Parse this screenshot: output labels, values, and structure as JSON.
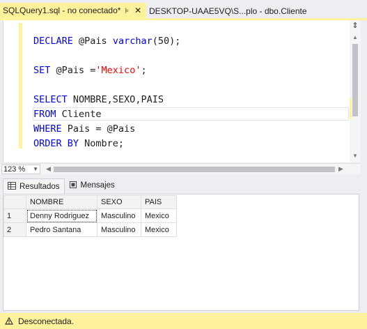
{
  "tabs": {
    "active": {
      "title": "SQLQuery1.sql - no conectado*",
      "pin": "⊧",
      "close": "✕"
    },
    "inactive": {
      "title": "DESKTOP-UAAE5VQ\\S...plo - dbo.Cliente"
    }
  },
  "editor": {
    "lines": [
      [
        {
          "t": "DECLARE",
          "c": "kw"
        },
        {
          "t": " @Pais ",
          "c": "txt"
        },
        {
          "t": "varchar",
          "c": "kw"
        },
        {
          "t": "(50);",
          "c": "txt"
        }
      ],
      [],
      [
        {
          "t": "SET",
          "c": "kw"
        },
        {
          "t": " @Pais =",
          "c": "txt"
        },
        {
          "t": "'Mexico'",
          "c": "str"
        },
        {
          "t": ";",
          "c": "txt"
        }
      ],
      [],
      [
        {
          "t": "SELECT",
          "c": "kw"
        },
        {
          "t": " NOMBRE,SEXO,PAIS",
          "c": "txt"
        }
      ],
      [
        {
          "t": "FROM",
          "c": "kw"
        },
        {
          "t": " Cliente",
          "c": "txt"
        }
      ],
      [
        {
          "t": "WHERE",
          "c": "kw"
        },
        {
          "t": " Pais = @Pais",
          "c": "txt"
        }
      ],
      [
        {
          "t": "ORDER BY",
          "c": "kw"
        },
        {
          "t": " Nombre;",
          "c": "txt"
        }
      ]
    ]
  },
  "zoom": {
    "value": "123 %"
  },
  "results": {
    "tabs": [
      {
        "label": "Resultados",
        "icon": "grid-icon"
      },
      {
        "label": "Mensajes",
        "icon": "messages-icon"
      }
    ],
    "columns": [
      "NOMBRE",
      "SEXO",
      "PAIS"
    ],
    "rows": [
      {
        "num": "1",
        "cells": [
          "Denny Rodriguez",
          "Masculino",
          "Mexico"
        ]
      },
      {
        "num": "2",
        "cells": [
          "Pedro Santana",
          "Masculino",
          "Mexico"
        ]
      }
    ]
  },
  "status": {
    "text": "Desconectada.",
    "icon": "disconnected-warning-icon"
  },
  "colors": {
    "accent_yellow": "#fff29d",
    "keyword_blue": "#0000ff",
    "string_red": "#ff0000"
  }
}
